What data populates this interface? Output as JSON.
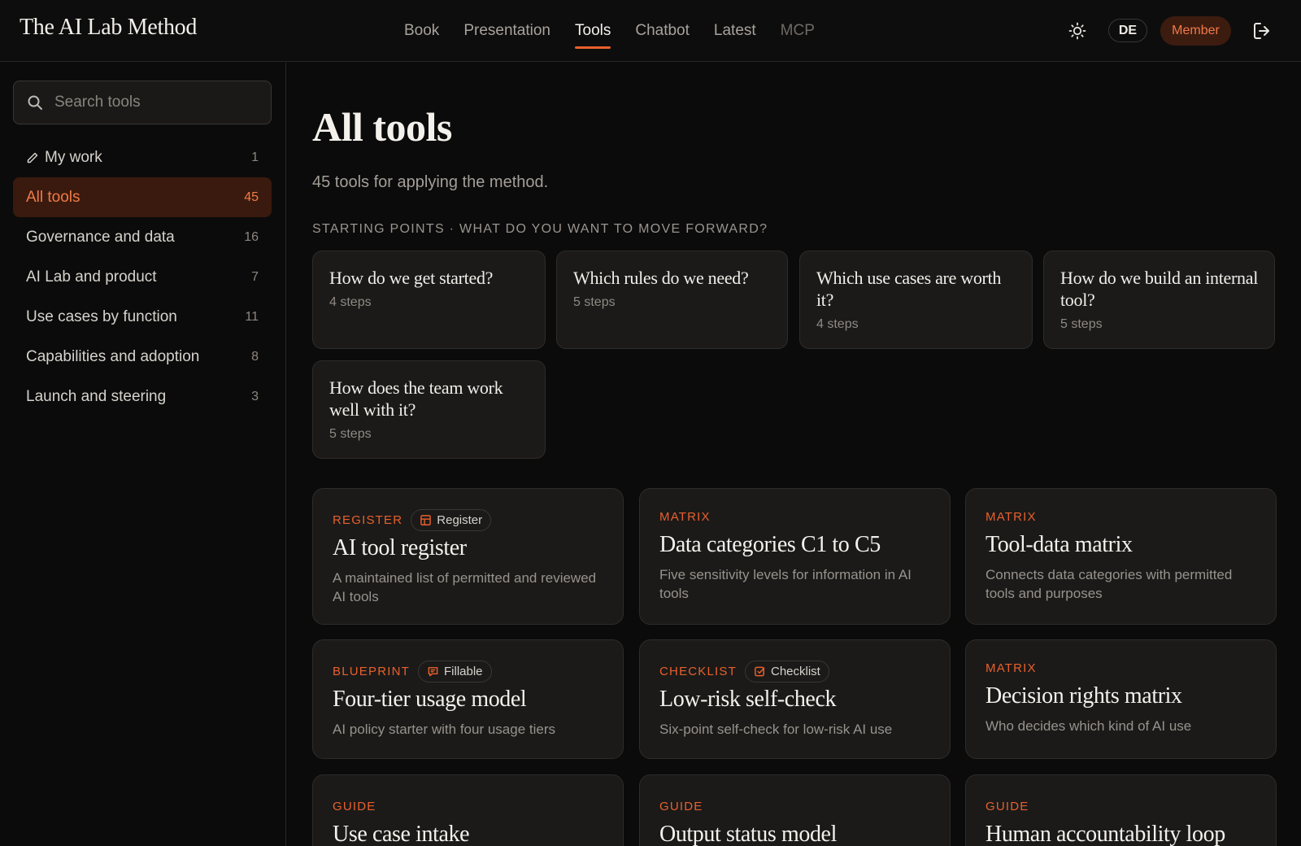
{
  "header": {
    "brand": "The AI Lab Method",
    "nav": [
      {
        "label": "Book"
      },
      {
        "label": "Presentation"
      },
      {
        "label": "Tools"
      },
      {
        "label": "Chatbot"
      },
      {
        "label": "Latest"
      },
      {
        "label": "MCP"
      }
    ],
    "active_nav": "Tools",
    "lang": "DE",
    "member": "Member",
    "accent": "#e8602c"
  },
  "sidebar": {
    "search_placeholder": "Search tools",
    "items": [
      {
        "label": "My work",
        "count": "1",
        "icon": "pencil-icon"
      },
      {
        "label": "All tools",
        "count": "45"
      },
      {
        "label": "Governance and data",
        "count": "16"
      },
      {
        "label": "AI Lab and product",
        "count": "7"
      },
      {
        "label": "Use cases by function",
        "count": "11"
      },
      {
        "label": "Capabilities and adoption",
        "count": "8"
      },
      {
        "label": "Launch and steering",
        "count": "3"
      }
    ],
    "active_item": "All tools"
  },
  "main": {
    "title": "All tools",
    "subtitle": "45 tools for applying the method.",
    "section_label": "STARTING POINTS · WHAT DO YOU WANT TO MOVE FORWARD?",
    "starting_points": [
      {
        "question": "How do we get started?",
        "steps": "4 steps"
      },
      {
        "question": "Which rules do we need?",
        "steps": "5 steps"
      },
      {
        "question": "Which use cases are worth it?",
        "steps": "4 steps"
      },
      {
        "question": "How do we build an internal tool?",
        "steps": "5 steps"
      },
      {
        "question": "How does the team work well with it?",
        "steps": "5 steps"
      }
    ],
    "tools": [
      {
        "type": "REGISTER",
        "pill": "Register",
        "pill_icon": "table-icon",
        "title": "AI tool register",
        "desc": "A maintained list of permitted and reviewed AI tools"
      },
      {
        "type": "MATRIX",
        "title": "Data categories C1 to C5",
        "desc": "Five sensitivity levels for information in AI tools"
      },
      {
        "type": "MATRIX",
        "title": "Tool-data matrix",
        "desc": "Connects data categories with permitted tools and purposes"
      },
      {
        "type": "BLUEPRINT",
        "pill": "Fillable",
        "pill_icon": "chat-icon",
        "title": "Four-tier usage model",
        "desc": "AI policy starter with four usage tiers"
      },
      {
        "type": "CHECKLIST",
        "pill": "Checklist",
        "pill_icon": "checkbox-icon",
        "title": "Low-risk self-check",
        "desc": "Six-point self-check for low-risk AI use"
      },
      {
        "type": "MATRIX",
        "title": "Decision rights matrix",
        "desc": "Who decides which kind of AI use"
      },
      {
        "type": "GUIDE",
        "title": "Use case intake",
        "desc": ""
      },
      {
        "type": "GUIDE",
        "title": "Output status model",
        "desc": ""
      },
      {
        "type": "GUIDE",
        "title": "Human accountability loop",
        "desc": ""
      }
    ]
  }
}
